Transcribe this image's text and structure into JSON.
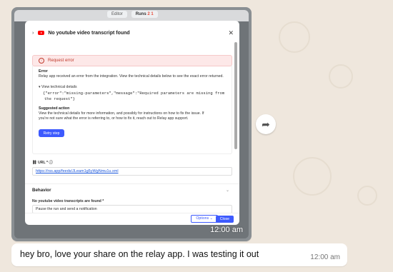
{
  "image_message": {
    "toolbar": {
      "editor": "Editor",
      "runs": "Runs",
      "runs_badge": "2 1"
    },
    "panel": {
      "title": "No youtube video transcript found",
      "error_banner": "Request error",
      "error_heading": "Error",
      "error_desc": "Relay app received an error from the integration. View the technical details below to see the exact error returned.",
      "view_details": "View technical details",
      "error_json_1": "{\"error\":\"missing-parameters\",\"message\":\"Required parameters are missing from",
      "error_json_2": "the request\"}",
      "suggested_heading": "Suggested action",
      "suggested_text_1": "View the technical details for more information, and possibly for instructions on how to fix the issue. If",
      "suggested_text_2": "you're not sure what the error is referring to, or how to fix it, reach out to Relay app support.",
      "retry_button": "Retry step",
      "url_label": "URL *",
      "url_value": "https://rss.app/feeds/JLeam1g5yWgNmu1u.xml",
      "behavior_heading": "Behavior",
      "behavior_label": "No youtube video transcripts are found *",
      "behavior_value": "Pause the run and send a notification",
      "options_button": "Options",
      "close_button": "Close"
    },
    "time": "12:00 am"
  },
  "text_message": {
    "text": "hey bro, love your share on the relay app. I was testing it out",
    "time": "12:00 am"
  }
}
